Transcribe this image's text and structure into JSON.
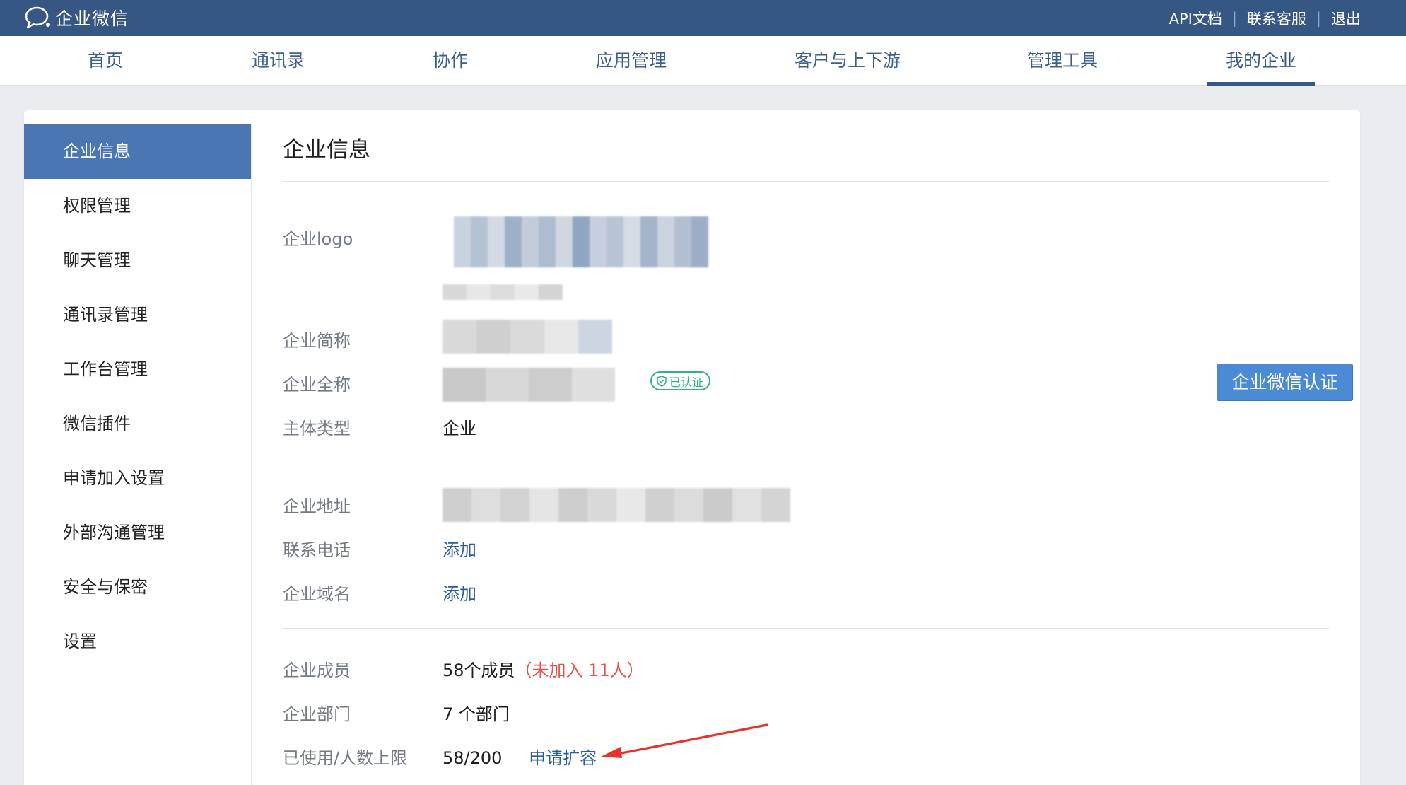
{
  "app": {
    "title": "企业微信"
  },
  "toplinks": {
    "api_docs": "API文档",
    "support": "联系客服",
    "logout": "退出",
    "sep": "|"
  },
  "nav": {
    "items": [
      {
        "label": "首页"
      },
      {
        "label": "通讯录"
      },
      {
        "label": "协作"
      },
      {
        "label": "应用管理"
      },
      {
        "label": "客户与上下游"
      },
      {
        "label": "管理工具"
      },
      {
        "label": "我的企业",
        "active": true
      }
    ]
  },
  "sidebar": {
    "items": [
      {
        "label": "企业信息",
        "active": true
      },
      {
        "label": "权限管理"
      },
      {
        "label": "聊天管理"
      },
      {
        "label": "通讯录管理"
      },
      {
        "label": "工作台管理"
      },
      {
        "label": "微信插件"
      },
      {
        "label": "申请加入设置"
      },
      {
        "label": "外部沟通管理"
      },
      {
        "label": "安全与保密"
      },
      {
        "label": "设置"
      }
    ]
  },
  "page": {
    "title": "企业信息",
    "logo_label": "企业logo",
    "short_name_label": "企业简称",
    "full_name_label": "企业全称",
    "verified_badge": "已认证",
    "verify_button": "企业微信认证",
    "entity_type_label": "主体类型",
    "entity_type_value": "企业",
    "address_label": "企业地址",
    "phone_label": "联系电话",
    "phone_action": "添加",
    "domain_label": "企业域名",
    "domain_action": "添加",
    "members_label": "企业成员",
    "members_value": "58个成员",
    "members_unjoined": "（未加入 11人）",
    "departments_label": "企业部门",
    "departments_value": "7 个部门",
    "limit_label": "已使用/人数上限",
    "limit_value": "58/200",
    "expand_action": "申请扩容"
  },
  "colors": {
    "topbar": "#365784",
    "accent": "#4a76b2",
    "link": "#2b5d9a",
    "verified": "#2fb87c",
    "warning": "#e2524b",
    "annotation_arrow": "#e8322c"
  }
}
